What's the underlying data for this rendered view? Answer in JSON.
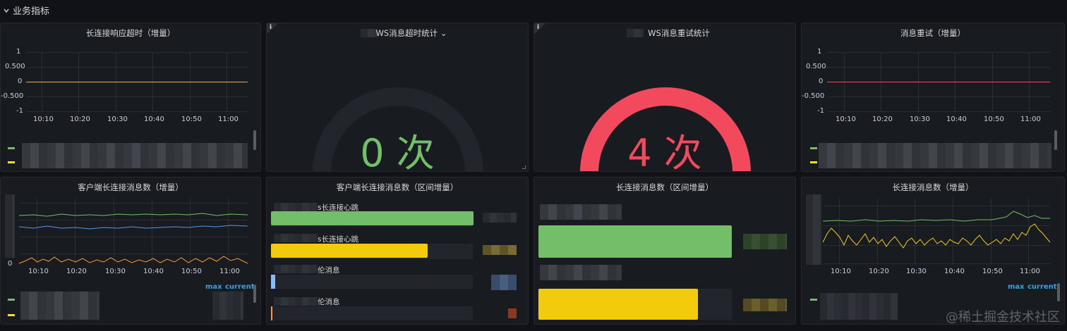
{
  "row": {
    "title": "业务指标"
  },
  "panels": {
    "p1": {
      "title": "长连接响应超时（增量）",
      "y_ticks": [
        "1",
        "0.500",
        "0",
        "-0.500",
        "-1"
      ],
      "x_ticks": [
        "10:10",
        "10:20",
        "10:30",
        "10:40",
        "10:50",
        "11:00"
      ],
      "legend_colors": [
        "#73bf69",
        "#fade2a"
      ]
    },
    "p2": {
      "title": "WS消息超时统计 ⌄",
      "value": "0 次",
      "gauge_fraction": 0,
      "color": "#73bf69"
    },
    "p3": {
      "title": "WS消息重试统计",
      "value": "4 次",
      "gauge_fraction": 1,
      "color": "#f2495c"
    },
    "p4": {
      "title": "消息重试（增量）",
      "y_ticks": [
        "1",
        "0.500",
        "0",
        "-0.500",
        "-1"
      ],
      "x_ticks": [
        "10:10",
        "10:20",
        "10:30",
        "10:40",
        "10:50",
        "11:00"
      ],
      "legend_colors": [
        "#73bf69",
        "#fade2a"
      ]
    },
    "p5": {
      "title": "客户端长连接消息数（增量）",
      "x_ticks": [
        "10:10",
        "10:20",
        "10:30",
        "10:40",
        "10:50",
        "11:00"
      ],
      "y_zero": "0",
      "legend_max": "max",
      "legend_current": "current"
    },
    "p6": {
      "title": "客户端长连接消息数（区间增量）",
      "bars": [
        {
          "label": "s长连接心跳",
          "fraction": 0.96,
          "color": "#73bf69"
        },
        {
          "label": "s长连接心跳",
          "fraction": 0.77,
          "color": "#f2cc0c"
        },
        {
          "label": "伦消息",
          "fraction": 0.02,
          "color": "#8ab8ff"
        },
        {
          "label": "伦消息",
          "fraction": 0.005,
          "color": "#ff9830"
        }
      ]
    },
    "p7": {
      "title": "长连接消息数（区间增量）",
      "bars": [
        {
          "fraction": 1.0,
          "color": "#73bf69"
        },
        {
          "fraction": 0.83,
          "color": "#f2cc0c"
        }
      ]
    },
    "p8": {
      "title": "长连接消息数（增量）",
      "x_ticks": [
        "10:10",
        "10:20",
        "10:30",
        "10:40",
        "10:50",
        "11:00"
      ],
      "legend_max": "max",
      "legend_current": "current"
    }
  },
  "watermark": "@稀土掘金技术社区",
  "chart_data": [
    {
      "type": "line",
      "title": "长连接响应超时（增量）",
      "x": [
        "10:10",
        "10:20",
        "10:30",
        "10:40",
        "10:50",
        "11:00"
      ],
      "series": [
        {
          "values": [
            0,
            0,
            0,
            0,
            0,
            0
          ]
        }
      ],
      "ylim": [
        -1,
        1
      ]
    },
    {
      "type": "line",
      "title": "消息重试（增量）",
      "x": [
        "10:10",
        "10:20",
        "10:30",
        "10:40",
        "10:50",
        "11:00"
      ],
      "series": [
        {
          "values": [
            0,
            0,
            0,
            0,
            0,
            0
          ]
        }
      ],
      "ylim": [
        -1,
        1
      ]
    }
  ]
}
